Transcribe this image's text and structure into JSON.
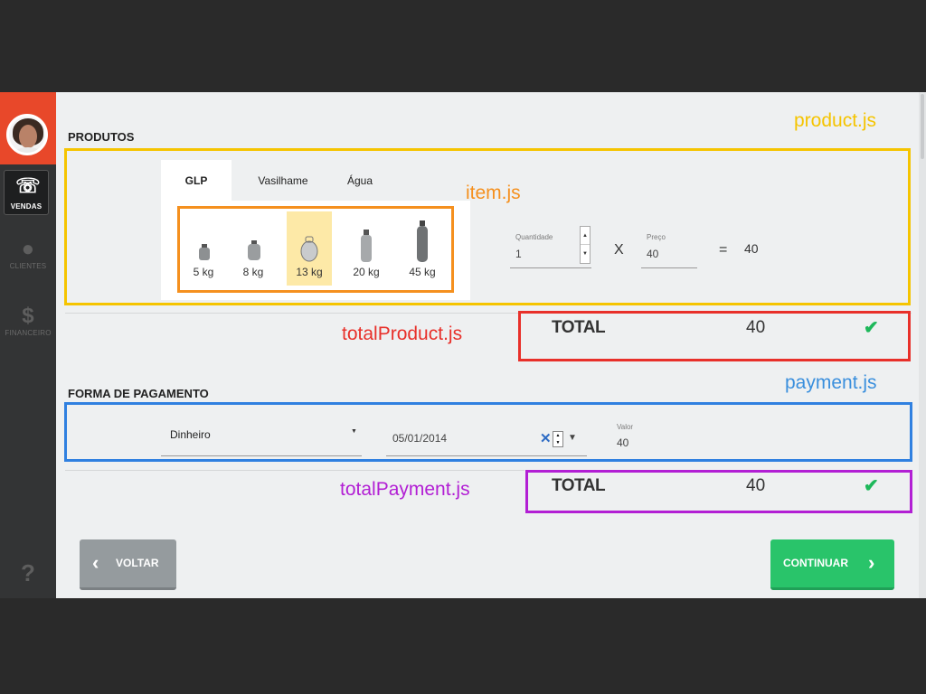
{
  "sidebar": {
    "vendas_icon": "phone-dollar-icon",
    "vendas_label": "VENDAS",
    "clientes_label": "CLIENTES",
    "financeiro_label": "FINANCEIRO",
    "help_glyph": "?"
  },
  "products": {
    "title": "PRODUTOS",
    "tabs": [
      "GLP",
      "Vasilhame",
      "Água"
    ],
    "items": [
      {
        "label": "5 kg"
      },
      {
        "label": "8 kg"
      },
      {
        "label": "13 kg",
        "selected": true
      },
      {
        "label": "20 kg"
      },
      {
        "label": "45 kg"
      }
    ],
    "quantity_label": "Quantidade",
    "quantity_value": "1",
    "times": "X",
    "price_label": "Preço",
    "price_value": "40",
    "equals": "=",
    "result": "40"
  },
  "total_product": {
    "label": "TOTAL",
    "value": "40"
  },
  "payment": {
    "title": "FORMA DE PAGAMENTO",
    "method": "Dinheiro",
    "date": "05/01/2014",
    "value_label": "Valor",
    "value": "40"
  },
  "total_payment": {
    "label": "TOTAL",
    "value": "40"
  },
  "annotations": {
    "product": "product.js",
    "item": "item.js",
    "total_product": "totalProduct.js",
    "payment": "payment.js",
    "total_payment": "totalPayment.js"
  },
  "buttons": {
    "back": "VOLTAR",
    "continue": "CONTINUAR"
  },
  "colors": {
    "brand": "#e8482a",
    "product_frame": "#f5c400",
    "item_frame": "#f5901e",
    "total_product_frame": "#e8302a",
    "payment_frame": "#2f80e0",
    "total_payment_frame": "#b21fd4",
    "success": "#1db85a"
  }
}
